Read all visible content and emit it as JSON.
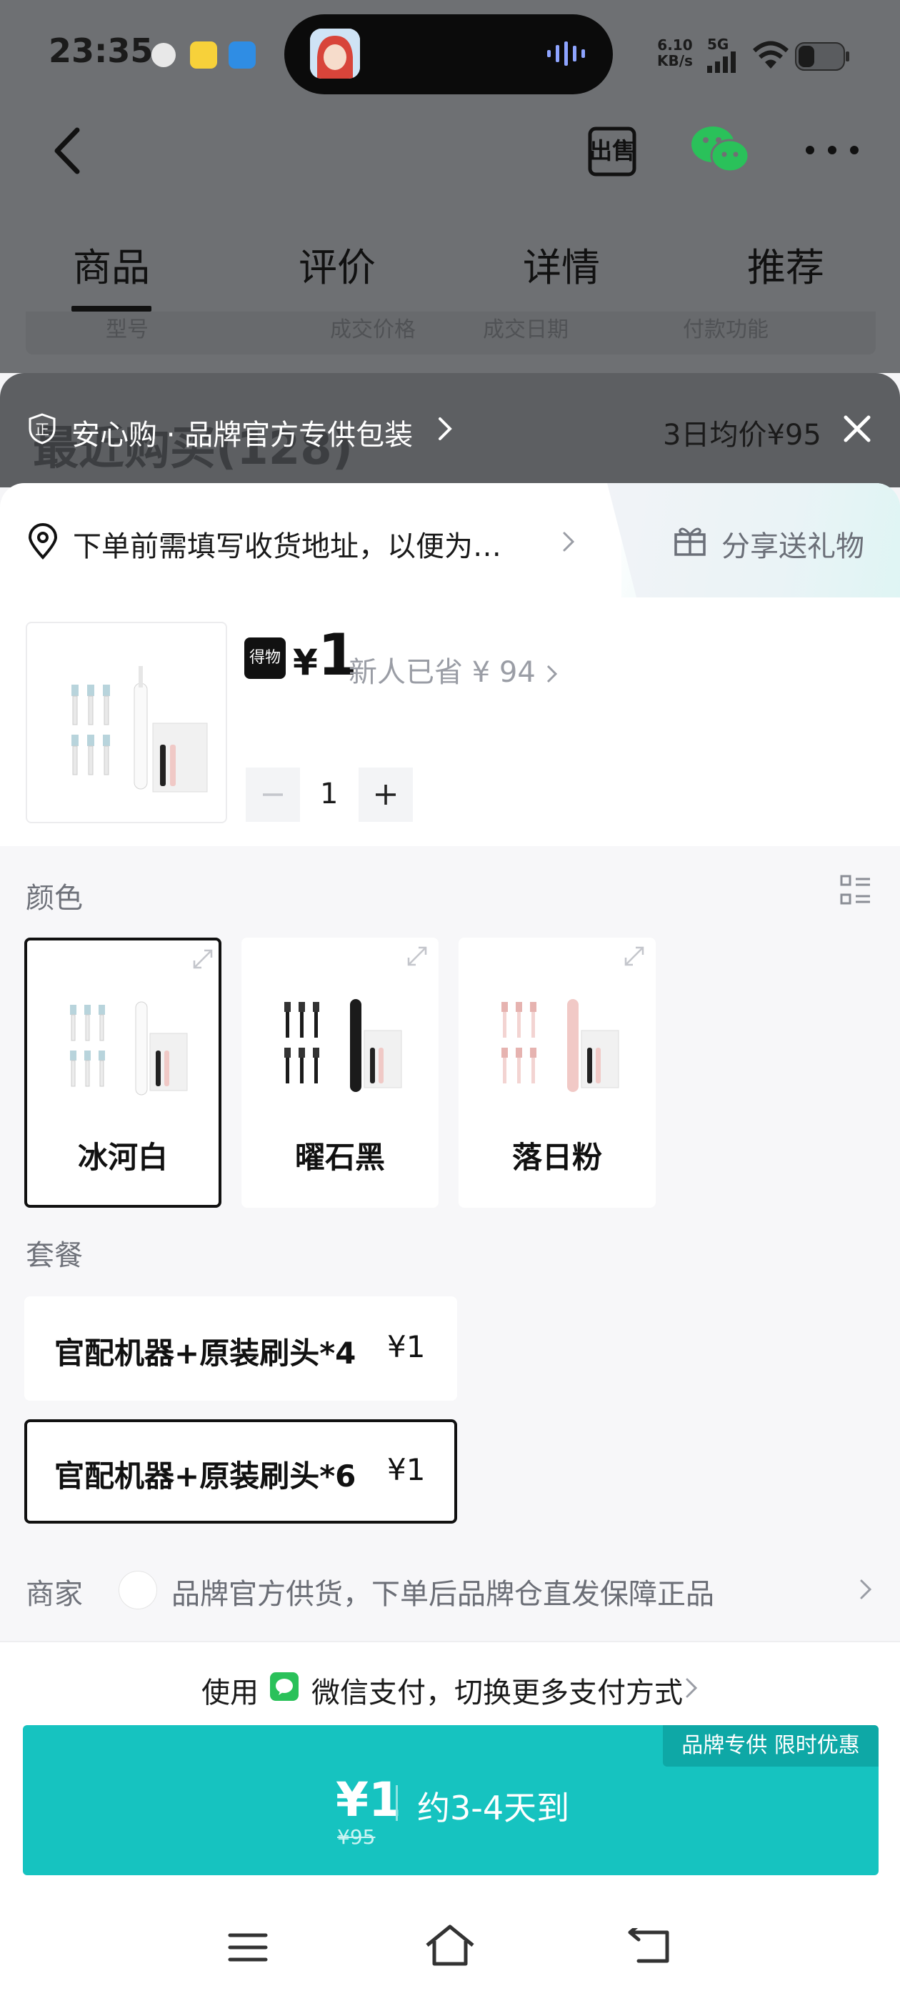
{
  "status_bar": {
    "time": "23:35",
    "network_speed": "6.10",
    "network_unit": "KB/s",
    "signal_label": "5G"
  },
  "header": {
    "tabs": [
      "商品",
      "评价",
      "详情",
      "推荐"
    ],
    "active_tab": "商品"
  },
  "background": {
    "ghost_title": "最近购买(128)",
    "ghost_columns": [
      "型号",
      "成交价格",
      "成交日期",
      "付款功能"
    ]
  },
  "promo_bar": {
    "badge": "正",
    "text": "安心购 · 品牌官方专供包装",
    "avg_price": "3日均价¥95"
  },
  "address": {
    "text": "下单前需填写收货地址，以便为…",
    "share_label": "分享送礼物"
  },
  "product": {
    "logo_text": "得物",
    "price_symbol": "¥",
    "price": "1",
    "saved_text": "新人已省 ¥ 94",
    "quantity": "1"
  },
  "color_section": {
    "label": "颜色",
    "options": [
      {
        "label": "冰河白",
        "selected": true,
        "brush_color": "#f2f2f2"
      },
      {
        "label": "曜石黑",
        "selected": false,
        "brush_color": "#1b1b1b"
      },
      {
        "label": "落日粉",
        "selected": false,
        "brush_color": "#f1c9c6"
      }
    ]
  },
  "package_section": {
    "label": "套餐",
    "options": [
      {
        "label": "官配机器+原装刷头*4",
        "price": "¥1",
        "selected": false
      },
      {
        "label": "官配机器+原装刷头*6",
        "price": "¥1",
        "selected": true
      }
    ]
  },
  "merchant": {
    "label": "商家",
    "text": "品牌官方供货，下单后品牌仓直发保障正品"
  },
  "payment": {
    "prefix": "使用",
    "method": "微信支付，切换更多支付方式"
  },
  "buy_button": {
    "badge": "品牌专供 限时优惠",
    "price": "¥1",
    "original_price": "¥95",
    "eta": "约3-4天到"
  },
  "colors": {
    "accent": "#16c3c0",
    "accent_dark": "#0ea8a6",
    "wechat_green": "#2ac15a"
  }
}
